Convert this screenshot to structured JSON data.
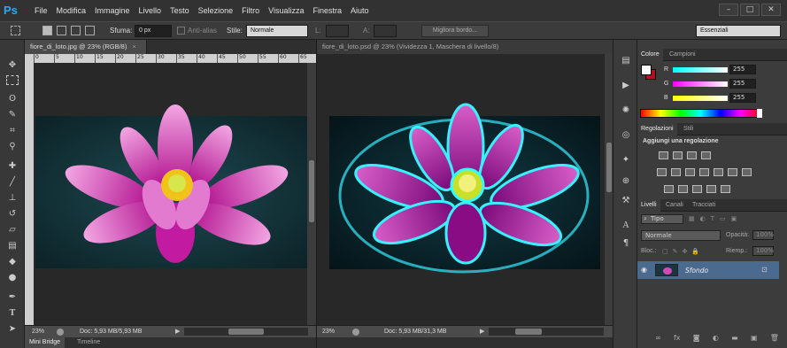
{
  "menubar": {
    "app_logo": "Ps",
    "items": [
      "File",
      "Modifica",
      "Immagine",
      "Livello",
      "Testo",
      "Selezione",
      "Filtro",
      "Visualizza",
      "Finestra",
      "Aiuto"
    ]
  },
  "options": {
    "sfuma_label": "Sfuma:",
    "sfuma_value": "0 px",
    "antialias_label": "Anti-alias",
    "stile_label": "Stile:",
    "stile_value": "Normale",
    "l_label": "L:",
    "a_label": "A:",
    "refine_label": "Migliora bordo...",
    "workspace": "Essenziali"
  },
  "doc1": {
    "tab_title": "fiore_di_loto.jpg @ 23% (RGB/8)",
    "ruler_ticks": [
      "0",
      "5",
      "10",
      "15",
      "20",
      "25",
      "30",
      "35",
      "40",
      "45",
      "50",
      "55",
      "60",
      "65"
    ],
    "zoom": "23%",
    "docinfo": "Doc: 5,93 MB/5,93 MB"
  },
  "doc2": {
    "tab_title": "fiore_di_loto.psd @ 23% (Vividezza 1, Maschera di livello/8)",
    "zoom": "23%",
    "docinfo": "Doc: 5,93 MB/31,3 MB"
  },
  "bottom_tabs": [
    "Mini Bridge",
    "Timeline"
  ],
  "color_panel": {
    "tabs": [
      "Colore",
      "Campioni"
    ],
    "r_label": "R",
    "r_value": "255",
    "g_label": "G",
    "g_value": "255",
    "b_label": "B",
    "b_value": "255"
  },
  "adjust_panel": {
    "tabs": [
      "Regolazioni",
      "Stili"
    ],
    "heading": "Aggiungi una regolazione"
  },
  "layers_panel": {
    "tabs": [
      "Livelli",
      "Canali",
      "Tracciati"
    ],
    "filter_kind": "Tipo",
    "blend_mode": "Normale",
    "opacity_label": "Opacità:",
    "opacity_value": "100%",
    "lock_label": "Bloc.:",
    "fill_label": "Riemp.:",
    "fill_value": "100%",
    "layer_name": "Sfondo"
  },
  "colors": {
    "app_bg": "#2a2a2a",
    "ps_blue": "#2aa8ff",
    "selected_layer": "#4b6a8f"
  }
}
